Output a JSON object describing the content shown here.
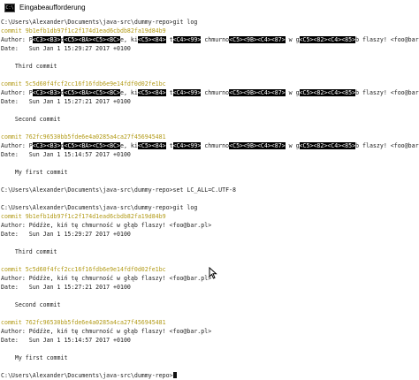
{
  "window": {
    "title": "Eingabeaufforderung",
    "icon": "cmd-icon"
  },
  "console": {
    "lines": [
      {
        "type": "text",
        "text": "C:\\Users\\Alexander\\Documents\\java-src\\dummy-repo>git log"
      },
      {
        "type": "commit",
        "text": "commit 9b1efb1db97f1c2f174d1ead6cbdb82fa19d84b9"
      },
      {
        "type": "segs",
        "segs": [
          {
            "t": "Author: P"
          },
          {
            "t": "<C3><B3>",
            "hl": true
          },
          {
            "t": "d"
          },
          {
            "t": "<C5><BA><C5><BC>",
            "hl": true
          },
          {
            "t": "e, ki"
          },
          {
            "t": "<C5><84>",
            "hl": true
          },
          {
            "t": " t"
          },
          {
            "t": "<C4><99>",
            "hl": true
          },
          {
            "t": " chmurno"
          },
          {
            "t": "<C5><9B><C4><87>",
            "hl": true
          },
          {
            "t": " w g"
          },
          {
            "t": "<C5><82><C4><85>",
            "hl": true
          },
          {
            "t": "b flaszy! <foo@bar.pl>"
          }
        ]
      },
      {
        "type": "text",
        "text": "Date:   Sun Jan 1 15:29:27 2017 +0100"
      },
      {
        "type": "blank"
      },
      {
        "type": "text",
        "text": "    Third commit"
      },
      {
        "type": "blank"
      },
      {
        "type": "commit",
        "text": "commit 5c5d60f4fcf2cc16f16fdb6e9e14fdf0d02fe1bc"
      },
      {
        "type": "segs",
        "segs": [
          {
            "t": "Author: P"
          },
          {
            "t": "<C3><B3>",
            "hl": true
          },
          {
            "t": "d"
          },
          {
            "t": "<C5><BA><C5><BC>",
            "hl": true
          },
          {
            "t": "e, ki"
          },
          {
            "t": "<C5><84>",
            "hl": true
          },
          {
            "t": " t"
          },
          {
            "t": "<C4><99>",
            "hl": true
          },
          {
            "t": " chmurno"
          },
          {
            "t": "<C5><9B><C4><87>",
            "hl": true
          },
          {
            "t": " w g"
          },
          {
            "t": "<C5><82><C4><85>",
            "hl": true
          },
          {
            "t": "b flaszy! <foo@bar.pl>"
          }
        ]
      },
      {
        "type": "text",
        "text": "Date:   Sun Jan 1 15:27:21 2017 +0100"
      },
      {
        "type": "blank"
      },
      {
        "type": "text",
        "text": "    Second commit"
      },
      {
        "type": "blank"
      },
      {
        "type": "commit",
        "text": "commit 762fc96530bb5fde6e4a0285a4ca27f456945481"
      },
      {
        "type": "segs",
        "segs": [
          {
            "t": "Author: P"
          },
          {
            "t": "<C3><B3>",
            "hl": true
          },
          {
            "t": "d"
          },
          {
            "t": "<C5><BA><C5><BC>",
            "hl": true
          },
          {
            "t": "e, ki"
          },
          {
            "t": "<C5><84>",
            "hl": true
          },
          {
            "t": " t"
          },
          {
            "t": "<C4><99>",
            "hl": true
          },
          {
            "t": " chmurno"
          },
          {
            "t": "<C5><9B><C4><87>",
            "hl": true
          },
          {
            "t": " w g"
          },
          {
            "t": "<C5><82><C4><85>",
            "hl": true
          },
          {
            "t": "b flaszy! <foo@bar.pl>"
          }
        ]
      },
      {
        "type": "text",
        "text": "Date:   Sun Jan 1 15:14:57 2017 +0100"
      },
      {
        "type": "blank"
      },
      {
        "type": "text",
        "text": "    My first commit"
      },
      {
        "type": "blank"
      },
      {
        "type": "text",
        "text": "C:\\Users\\Alexander\\Documents\\java-src\\dummy-repo>set LC_ALL=C.UTF-8"
      },
      {
        "type": "blank"
      },
      {
        "type": "text",
        "text": "C:\\Users\\Alexander\\Documents\\java-src\\dummy-repo>git log"
      },
      {
        "type": "commit",
        "text": "commit 9b1efb1db97f1c2f174d1ead6cbdb82fa19d84b9"
      },
      {
        "type": "text",
        "text": "Author: Pódźże, kiń tę chmurność w głąb flaszy! <foo@bar.pl>"
      },
      {
        "type": "text",
        "text": "Date:   Sun Jan 1 15:29:27 2017 +0100"
      },
      {
        "type": "blank"
      },
      {
        "type": "text",
        "text": "    Third commit"
      },
      {
        "type": "blank"
      },
      {
        "type": "commit",
        "text": "commit 5c5d60f4fcf2cc16f16fdb6e9e14fdf0d02fe1bc"
      },
      {
        "type": "text",
        "text": "Author: Pódźże, kiń tę chmurność w głąb flaszy! <foo@bar.pl>"
      },
      {
        "type": "text",
        "text": "Date:   Sun Jan 1 15:27:21 2017 +0100"
      },
      {
        "type": "blank"
      },
      {
        "type": "text",
        "text": "    Second commit"
      },
      {
        "type": "blank"
      },
      {
        "type": "commit",
        "text": "commit 762fc96530bb5fde6e4a0285a4ca27f456945481"
      },
      {
        "type": "text",
        "text": "Author: Pódźże, kiń tę chmurność w głąb flaszy! <foo@bar.pl>"
      },
      {
        "type": "text",
        "text": "Date:   Sun Jan 1 15:14:57 2017 +0100"
      },
      {
        "type": "blank"
      },
      {
        "type": "text",
        "text": "    My first commit"
      },
      {
        "type": "blank"
      },
      {
        "type": "prompt",
        "text": "C:\\Users\\Alexander\\Documents\\java-src\\dummy-repo>"
      }
    ]
  },
  "colors": {
    "background": "#ffffff",
    "text": "#222222",
    "commit": "#b29a16",
    "highlight_bg": "#000000",
    "highlight_fg": "#ffffff"
  },
  "icons": {
    "cursor": "text-cursor-icon",
    "mouse": "mouse-pointer-icon"
  }
}
